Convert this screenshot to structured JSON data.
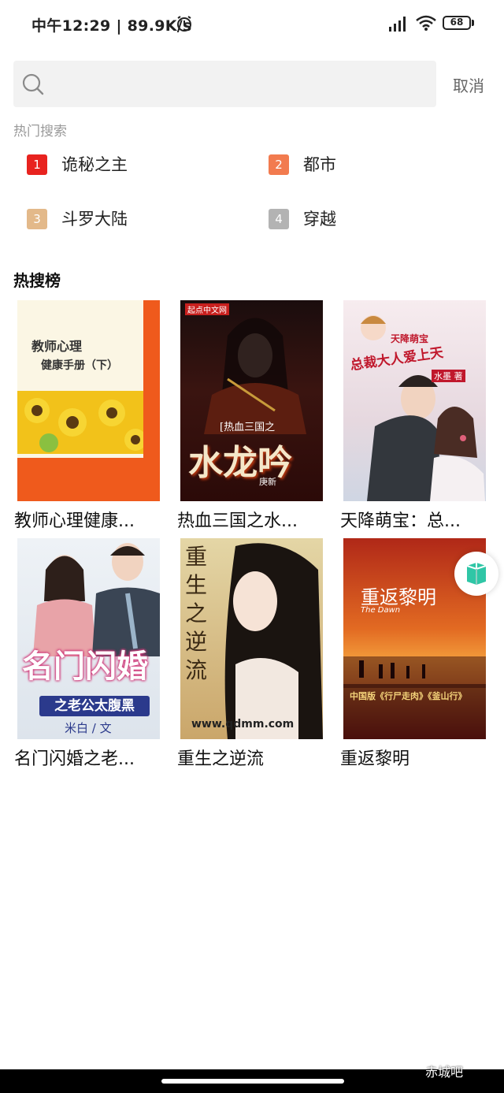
{
  "status_bar": {
    "time_speed": "中午12:29 | 89.9K/s",
    "battery": "68"
  },
  "search": {
    "placeholder": "",
    "value": "",
    "cancel_label": "取消"
  },
  "hot_search": {
    "title": "热门搜索",
    "items": [
      {
        "rank": "1",
        "label": "诡秘之主",
        "color": "#e8231f"
      },
      {
        "rank": "2",
        "label": "都市",
        "color": "#f27b4f"
      },
      {
        "rank": "3",
        "label": "斗罗大陆",
        "color": "#e3b98a"
      },
      {
        "rank": "4",
        "label": "穿越",
        "color": "#b3b3b3"
      }
    ]
  },
  "ranking": {
    "title": "热搜榜",
    "books": [
      {
        "title": "教师心理健康...",
        "cover_text": [
          "教师心理",
          "健康手册（下）"
        ]
      },
      {
        "title": "热血三国之水...",
        "cover_text": [
          "起点中文网",
          "[热血三国之",
          "水龙吟",
          "庚新"
        ]
      },
      {
        "title": "天降萌宝：总...",
        "cover_text": [
          "天降萌宝",
          "总裁大人爱上天",
          "水墨 著"
        ]
      },
      {
        "title": "名门闪婚之老...",
        "cover_text": [
          "名门闪婚",
          "之老公太腹黑",
          "米白 / 文"
        ]
      },
      {
        "title": "重生之逆流",
        "cover_text": [
          "重",
          "生",
          "之",
          "逆",
          "流",
          "www.qdmm.com"
        ]
      },
      {
        "title": "重返黎明",
        "cover_text": [
          "重返黎明",
          "The Dawn",
          "中国版《行尸走肉》《釜山行》"
        ]
      }
    ]
  },
  "watermark": "赤城吧",
  "colors": {
    "accent_red": "#e8231f",
    "search_bg": "#f2f2f2"
  }
}
